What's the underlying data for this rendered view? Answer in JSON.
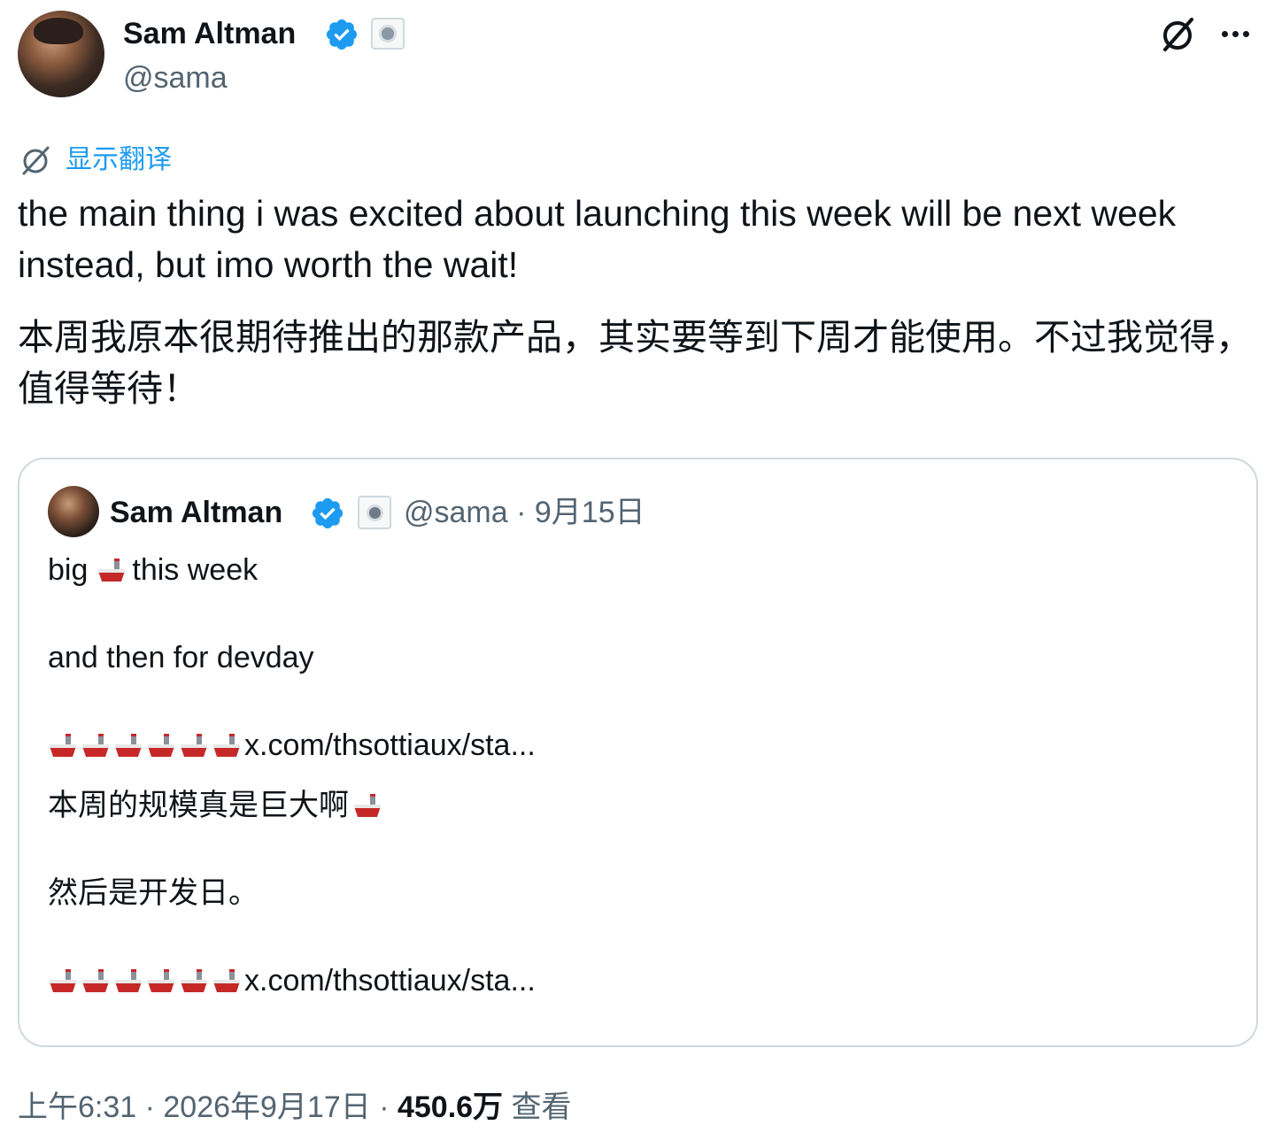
{
  "author": {
    "name": "Sam Altman",
    "handle": "@sama"
  },
  "translate": {
    "label": "显示翻译"
  },
  "tweet": {
    "text_en": "the main thing i was excited about launching this week will be next week instead, but imo worth the wait!",
    "text_zh": "本周我原本很期待推出的那款产品，其实要等到下周才能使用。不过我觉得，值得等待！"
  },
  "quote": {
    "name": "Sam Altman",
    "meta": "@sama · 9月15日",
    "line1_before": "big",
    "line1_after": "this week",
    "line2": "and then for devday",
    "link1": "x.com/thsottiaux/sta...",
    "line3_zh": "本周的规模真是巨大啊",
    "line4_zh": "然后是开发日。",
    "link2": "x.com/thsottiaux/sta..."
  },
  "footer": {
    "time_date": "上午6:31 · 2026年9月17日 · ",
    "views_count": "450.6万",
    "views_label": " 查看"
  },
  "colors": {
    "link": "#1d9bf0",
    "verified": "#1d9bf0",
    "secondary_text": "#536471"
  }
}
